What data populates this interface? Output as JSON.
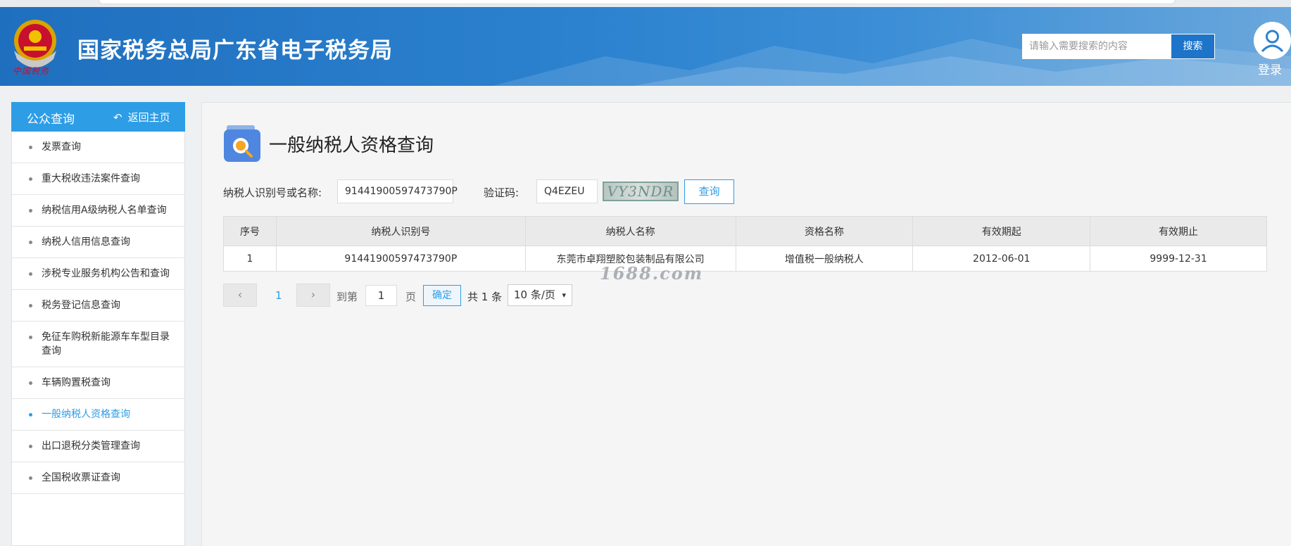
{
  "header": {
    "emblem_text": "中国税务",
    "site_title": "国家税务总局广东省电子税务局",
    "search_placeholder": "请输入需要搜索的内容",
    "search_button": "搜索",
    "login_label": "登录"
  },
  "sidebar": {
    "title": "公众查询",
    "back_label": "返回主页",
    "items": [
      {
        "label": "发票查询"
      },
      {
        "label": "重大税收违法案件查询"
      },
      {
        "label": "纳税信用A级纳税人名单查询"
      },
      {
        "label": "纳税人信用信息查询"
      },
      {
        "label": "涉税专业服务机构公告和查询"
      },
      {
        "label": "税务登记信息查询"
      },
      {
        "label": "免征车购税新能源车车型目录查询"
      },
      {
        "label": "车辆购置税查询"
      },
      {
        "label": "一般纳税人资格查询"
      },
      {
        "label": "出口退税分类管理查询"
      },
      {
        "label": "全国税收票证查询"
      }
    ],
    "active_index": 8
  },
  "main": {
    "page_title": "一般纳税人资格查询",
    "form": {
      "taxpayer_label": "纳税人识别号或名称:",
      "taxpayer_value": "91441900597473790P",
      "captcha_label": "验证码:",
      "captcha_value": "Q4EZEU",
      "captcha_image_text": "VY3NDR",
      "query_button": "查询"
    },
    "table": {
      "headers": [
        "序号",
        "纳税人识别号",
        "纳税人名称",
        "资格名称",
        "有效期起",
        "有效期止"
      ],
      "rows": [
        [
          "1",
          "91441900597473790P",
          "东莞市卓翔塑胶包装制品有限公司",
          "增值税一般纳税人",
          "2012-06-01",
          "9999-12-31"
        ]
      ]
    },
    "pagination": {
      "prev": "‹",
      "current_page": "1",
      "next": "›",
      "goto_prefix": "到第",
      "goto_value": "1",
      "goto_suffix": "页",
      "confirm": "确定",
      "total_text": "共 1 条",
      "page_size": "10 条/页"
    },
    "watermark": "1688.com"
  }
}
